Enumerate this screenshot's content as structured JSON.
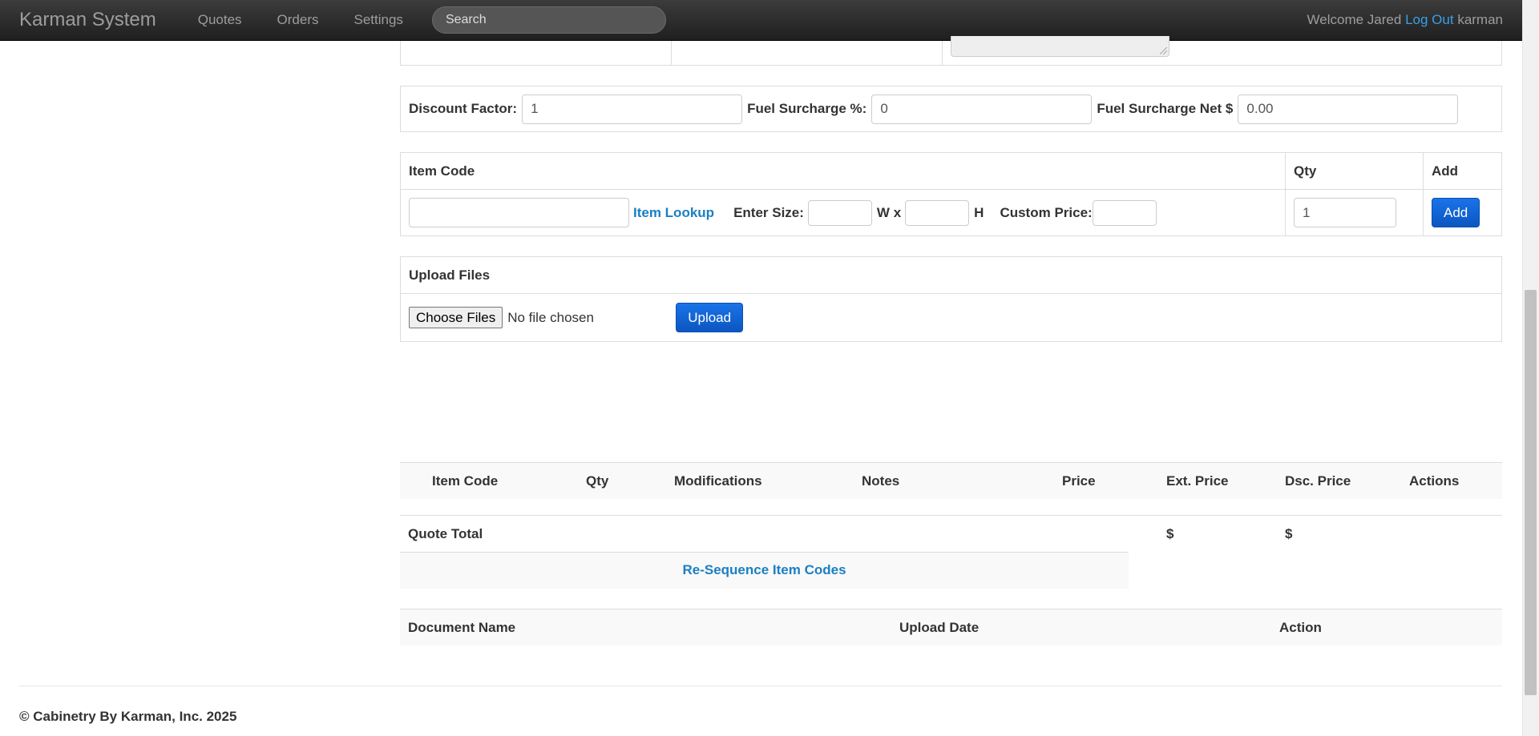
{
  "nav": {
    "brand": "Karman System",
    "links": [
      "Quotes",
      "Orders",
      "Settings"
    ],
    "search_placeholder": "Search",
    "welcome": "Welcome Jared",
    "logout": "Log Out",
    "username": "karman"
  },
  "pricing": {
    "discount_label": "Discount Factor:",
    "discount_value": "1",
    "fuel_pct_label": "Fuel Surcharge %:",
    "fuel_pct_value": "0",
    "fuel_net_label": "Fuel Surcharge Net $",
    "fuel_net_value": "0.00"
  },
  "item_entry": {
    "headers": {
      "item_code": "Item Code",
      "qty": "Qty",
      "add": "Add"
    },
    "item_lookup": "Item Lookup",
    "enter_size": "Enter Size:",
    "w_x": "W x",
    "h": "H",
    "custom_price": "Custom Price:",
    "qty_value": "1",
    "add_button": "Add"
  },
  "upload": {
    "title": "Upload Files",
    "choose": "Choose Files",
    "status": "No file chosen",
    "button": "Upload"
  },
  "lines": {
    "headers": [
      "Item Code",
      "Qty",
      "Modifications",
      "Notes",
      "Price",
      "Ext. Price",
      "Dsc. Price",
      "Actions"
    ],
    "total_label": "Quote Total",
    "ext_total": "$",
    "dsc_total": "$",
    "resequence": "Re-Sequence Item Codes"
  },
  "documents": {
    "headers": [
      "Document Name",
      "Upload Date",
      "Action"
    ]
  },
  "footer": "© Cabinetry By Karman, Inc. 2025"
}
